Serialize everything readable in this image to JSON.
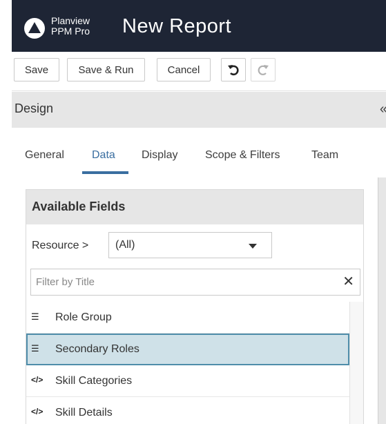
{
  "header": {
    "brand_line1": "Planview",
    "brand_line2": "PPM Pro",
    "title": "New Report"
  },
  "toolbar": {
    "save_label": "Save",
    "save_run_label": "Save & Run",
    "cancel_label": "Cancel",
    "undo_icon": "undo-icon",
    "redo_icon": "redo-icon"
  },
  "design": {
    "label": "Design",
    "collapse_glyph": "«"
  },
  "tabs": [
    {
      "label": "General",
      "active": false
    },
    {
      "label": "Data",
      "active": true
    },
    {
      "label": "Display",
      "active": false
    },
    {
      "label": "Scope & Filters",
      "active": false
    },
    {
      "label": "Team",
      "active": false
    }
  ],
  "available_fields": {
    "title": "Available Fields",
    "resource_label": "Resource  >",
    "resource_select_value": "(All)",
    "filter_placeholder": "Filter by Title",
    "clear_glyph": "✕",
    "items": [
      {
        "label": "Role Group",
        "icon": "list-icon",
        "icon_glyph": "☰",
        "selected": false
      },
      {
        "label": "Secondary Roles",
        "icon": "list-icon",
        "icon_glyph": "☰",
        "selected": true
      },
      {
        "label": "Skill Categories",
        "icon": "code-icon",
        "icon_glyph": "</>",
        "selected": false
      },
      {
        "label": "Skill Details",
        "icon": "code-icon",
        "icon_glyph": "</>",
        "selected": false
      }
    ]
  },
  "colors": {
    "header_bg": "#1e2535",
    "accent": "#3a6ea0",
    "selected_bg": "#cfe1e8",
    "selected_border": "#4f8daa",
    "panel_header_bg": "#e6e6e6"
  }
}
